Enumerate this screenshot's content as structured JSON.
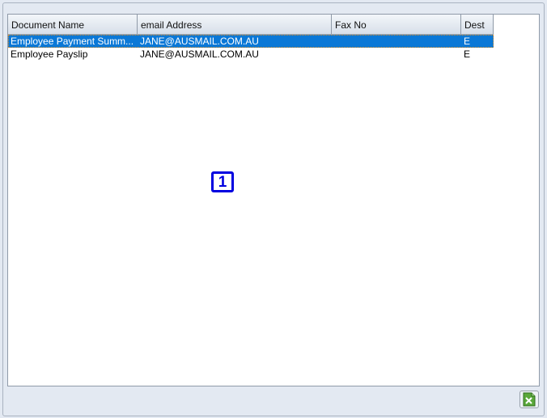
{
  "table": {
    "columns": [
      "Document Name",
      "email Address",
      "Fax No",
      "Dest"
    ],
    "rows": [
      {
        "document_name": "Employee Payment Summ...",
        "email": "JANE@AUSMAIL.COM.AU",
        "fax": "",
        "dest": "E",
        "selected": true
      },
      {
        "document_name": "Employee Payslip",
        "email": "JANE@AUSMAIL.COM.AU",
        "fax": "",
        "dest": "E",
        "selected": false
      }
    ]
  },
  "marker_label": "1",
  "export_button": {
    "icon": "excel-export-icon"
  },
  "colors": {
    "selection": "#0a78d7",
    "marker": "#0000e0",
    "panel": "#e3e9f2"
  }
}
